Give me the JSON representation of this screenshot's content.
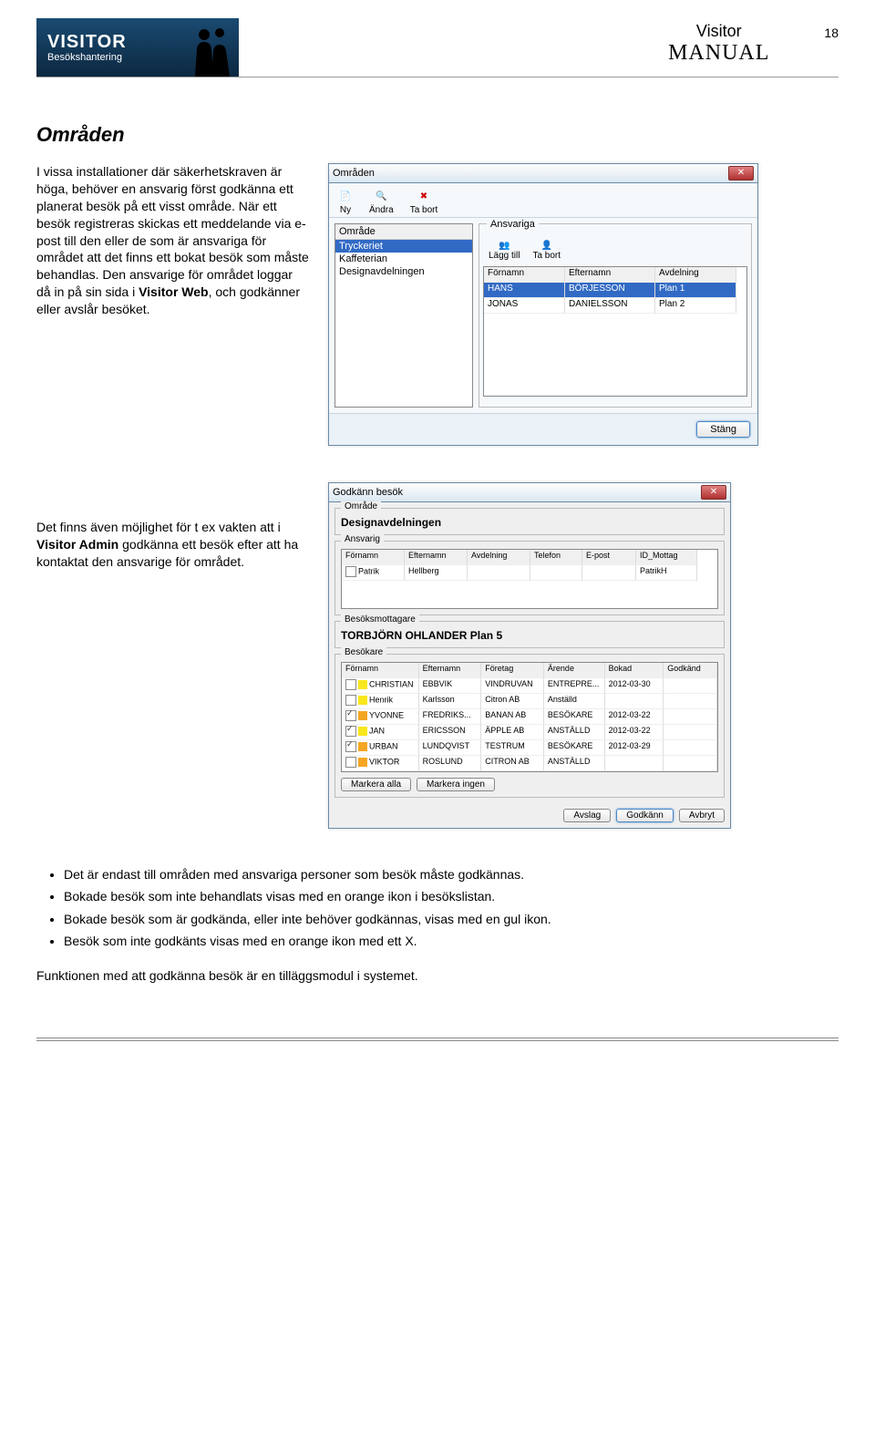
{
  "header": {
    "logo_title": "VISITOR",
    "logo_sub": "Besökshantering",
    "manual_top": "Visitor",
    "manual_big": "MANUAL",
    "page": "18"
  },
  "section_title": "Områden",
  "para1": "I vissa installationer där säkerhetskraven är höga, behöver en ansvarig först godkänna ett planerat besök på ett visst område. När ett besök registreras skickas ett meddelande via e-post till den eller de som är ansvariga för området att det finns ett bokat besök som måste behandlas. Den ansvarige för området loggar då in på sin sida i",
  "para1_bold": "Visitor Web",
  "para1_tail": ", och godkänner eller avslår besöket.",
  "para2_lead": "Det finns även möjlighet för t ex vakten att i ",
  "para2_bold": "Visitor Admin",
  "para2_tail": " godkänna ett besök efter att ha kontaktat den ansvarige för området.",
  "fig1": {
    "title": "Områden",
    "tool_ny": "Ny",
    "tool_andra": "Ändra",
    "tool_tabort": "Ta bort",
    "col_omrade": "Område",
    "items": [
      "Tryckeriet",
      "Kaffeterian",
      "Designavdelningen"
    ],
    "grp_ansvariga": "Ansvariga",
    "mini_lagg": "Lägg till",
    "mini_tabort": "Ta bort",
    "gcols": [
      "Förnamn",
      "Efternamn",
      "Avdelning"
    ],
    "rows": [
      [
        "HANS",
        "BÖRJESSON",
        "Plan 1"
      ],
      [
        "JONAS",
        "DANIELSSON",
        "Plan 2"
      ]
    ],
    "close": "Stäng"
  },
  "fig2": {
    "title": "Godkänn besök",
    "grp_omrade": "Område",
    "omrade_val": "Designavdelningen",
    "grp_ansvarig": "Ansvarig",
    "acols": [
      "Förnamn",
      "Efternamn",
      "Avdelning",
      "Telefon",
      "E-post",
      "ID_Mottag"
    ],
    "arow": [
      "Patrik",
      "Hellberg",
      "",
      "",
      "",
      "PatrikH"
    ],
    "grp_mottagare": "Besöksmottagare",
    "mottagare_val": "TORBJÖRN OHLANDER Plan 5",
    "grp_besokare": "Besökare",
    "bcols": [
      "Förnamn",
      "Efternamn",
      "Företag",
      "Ärende",
      "Bokad",
      "Godkänd"
    ],
    "brows": [
      {
        "chk": false,
        "col": "ye",
        "c": [
          "CHRISTIAN",
          "EBBVIK",
          "VINDRUVAN",
          "ENTREPRE...",
          "2012-03-30",
          ""
        ]
      },
      {
        "chk": false,
        "col": "ye",
        "c": [
          "Henrik",
          "Karlsson",
          "Citron AB",
          "Anställd",
          "",
          ""
        ]
      },
      {
        "chk": true,
        "col": "or",
        "c": [
          "YVONNE",
          "FREDRIKS...",
          "BANAN AB",
          "BESÖKARE",
          "2012-03-22",
          ""
        ]
      },
      {
        "chk": true,
        "col": "ye",
        "c": [
          "JAN",
          "ERICSSON",
          "ÄPPLE AB",
          "ANSTÄLLD",
          "2012-03-22",
          ""
        ]
      },
      {
        "chk": true,
        "col": "or",
        "c": [
          "URBAN",
          "LUNDQVIST",
          "TESTRUM",
          "BESÖKARE",
          "2012-03-29",
          ""
        ]
      },
      {
        "chk": false,
        "col": "or",
        "c": [
          "VIKTOR",
          "ROSLUND",
          "CITRON AB",
          "ANSTÄLLD",
          "",
          ""
        ]
      }
    ],
    "btn_markera_alla": "Markera alla",
    "btn_markera_ingen": "Markera ingen",
    "btn_avsla": "Avslag",
    "btn_godkann": "Godkänn",
    "btn_avbryt": "Avbryt"
  },
  "bullets": [
    "Det är endast till områden med ansvariga personer som besök måste godkännas.",
    "Bokade besök som inte behandlats visas med en orange ikon i besökslistan.",
    "Bokade besök som är godkända, eller inte behöver godkännas, visas med en gul ikon.",
    "Besök som inte godkänts visas med en orange ikon med ett X."
  ],
  "final": "Funktionen med att godkänna besök är en tilläggsmodul i systemet."
}
